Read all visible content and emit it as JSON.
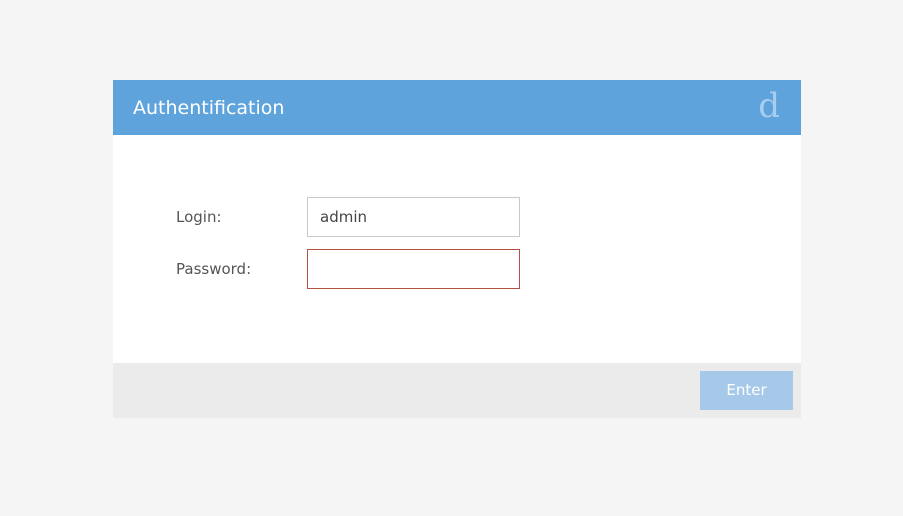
{
  "colors": {
    "page_background": "#f5f5f5",
    "header_background": "#5fa3dd",
    "logo": "#a8cdee",
    "footer_background": "#ebebeb",
    "button_disabled_background": "#a6c9e9",
    "invalid_input_border": "#b5523e"
  },
  "dialog": {
    "title": "Authentification",
    "logo_text": "d"
  },
  "form": {
    "login_label": "Login:",
    "login_value": "admin",
    "password_label": "Password:",
    "password_value": "",
    "password_state": "invalid"
  },
  "footer": {
    "enter_label": "Enter",
    "enter_state": "disabled"
  }
}
